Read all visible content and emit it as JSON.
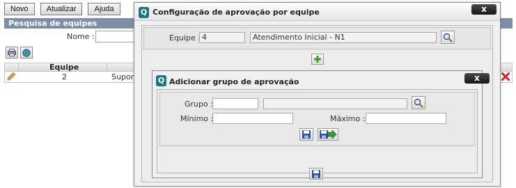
{
  "toolbar": {
    "new_label": "Novo",
    "refresh_label": "Atualizar",
    "help_label": "Ajuda"
  },
  "search_panel": {
    "title": "Pesquisa de equipes",
    "name_label": "Nome :",
    "name_value": ""
  },
  "table": {
    "columns": [
      "Equipe"
    ],
    "rows": [
      {
        "equipe": "2",
        "nome_partial": "Supor"
      }
    ]
  },
  "dialog": {
    "title": "Configuração de aprovação por equipe",
    "close_label": "x",
    "team_label": "Equipe :",
    "team_id": "4",
    "team_name": "Atendimento Inicial - N1"
  },
  "sub_dialog": {
    "title": "Adicionar grupo de aprovação",
    "close_label": "x",
    "group_label": "Grupo :",
    "group_id": "",
    "group_name": "",
    "min_label": "Mínimo :",
    "min_value": "",
    "max_label": "Máximo :",
    "max_value": ""
  },
  "colors": {
    "panel_header": "#7d8ea8",
    "logo_teal": "#137a83",
    "close_button": "#1f1f1f",
    "icon_blue": "#2b4e9c",
    "icon_green": "#3a9a2a",
    "delete_red": "#cc1f1f"
  },
  "icons": [
    "print-icon",
    "globe-icon",
    "edit-pencil-icon",
    "delete-icon",
    "search-magnifier-icon",
    "add-plus-icon",
    "save-disk-icon",
    "save-and-next-icon",
    "app-logo-icon"
  ]
}
